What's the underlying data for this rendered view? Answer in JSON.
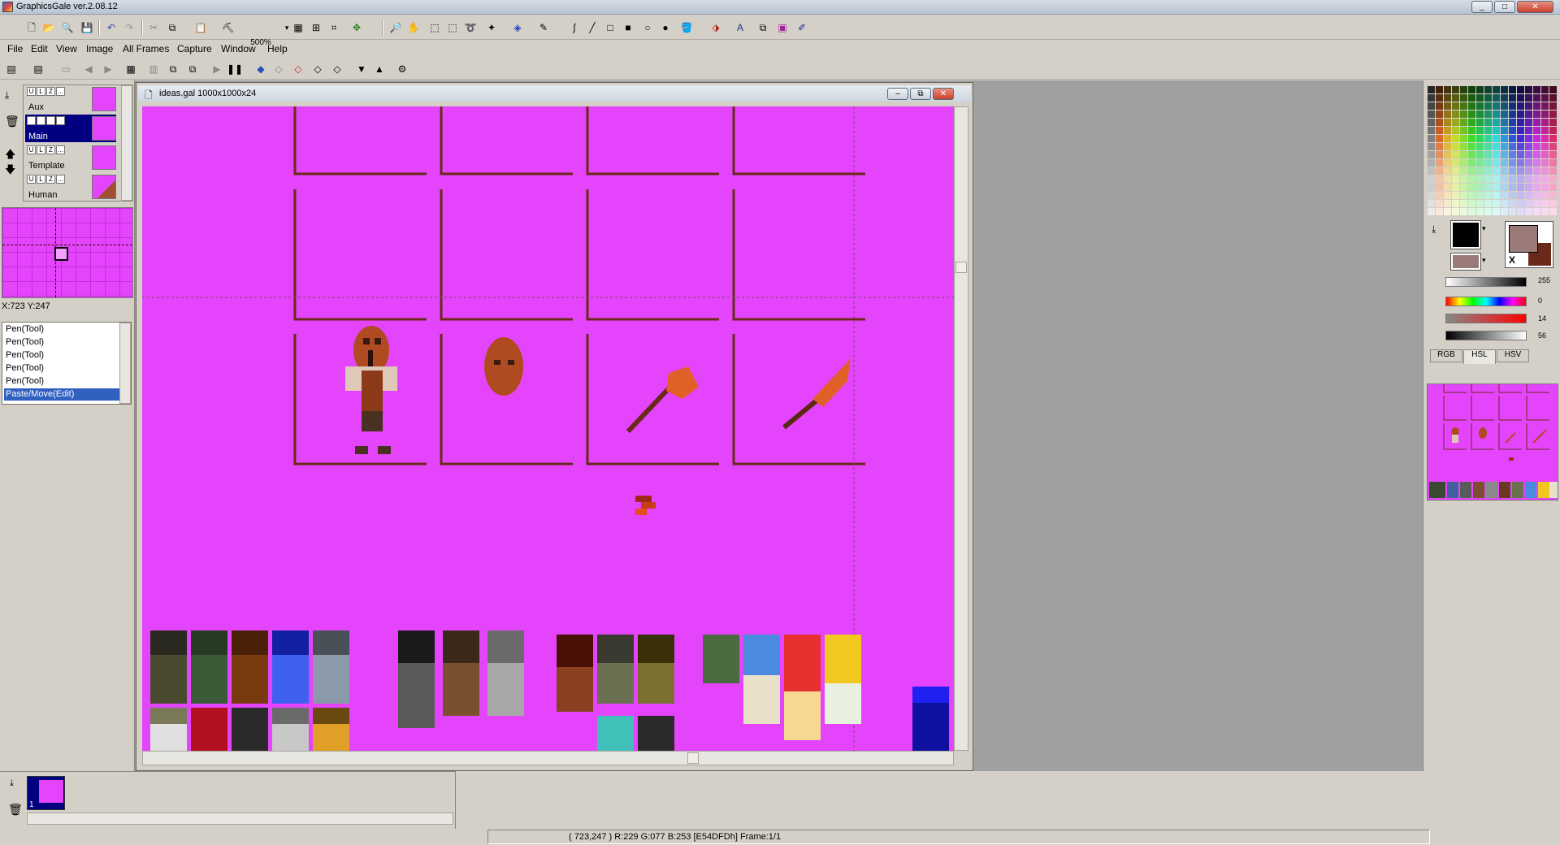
{
  "window": {
    "title": "GraphicsGale ver.2.08.12",
    "min": "_",
    "max": "□",
    "close": "✕"
  },
  "zoom": "500%",
  "menu": [
    "File",
    "Edit",
    "View",
    "Image",
    "All Frames",
    "Capture",
    "Window",
    "Help"
  ],
  "layers": [
    {
      "name": "Aux",
      "selected": false
    },
    {
      "name": "Main",
      "selected": true
    },
    {
      "name": "Template",
      "selected": false
    },
    {
      "name": "Human",
      "selected": false
    }
  ],
  "coords": "X:723 Y:247",
  "history": [
    "Pen(Tool)",
    "Pen(Tool)",
    "Pen(Tool)",
    "Pen(Tool)",
    "Pen(Tool)",
    "Paste/Move(Edit)"
  ],
  "document": {
    "title": "ideas.gal 1000x1000x24",
    "background": "#e544fd"
  },
  "colors": {
    "primary": "#000000",
    "secondary": "#9a7a78",
    "alt": "#6a2a1a",
    "magenta": "#e544fd"
  },
  "sliders": {
    "top": "255",
    "h": "0",
    "s": "14",
    "l": "56"
  },
  "color_tabs": [
    "RGB",
    "HSL",
    "HSV"
  ],
  "frame_label": "1",
  "status": "( 723,247 ) R:229 G:077 B:253   [E54DFDh]   Frame:1/1"
}
